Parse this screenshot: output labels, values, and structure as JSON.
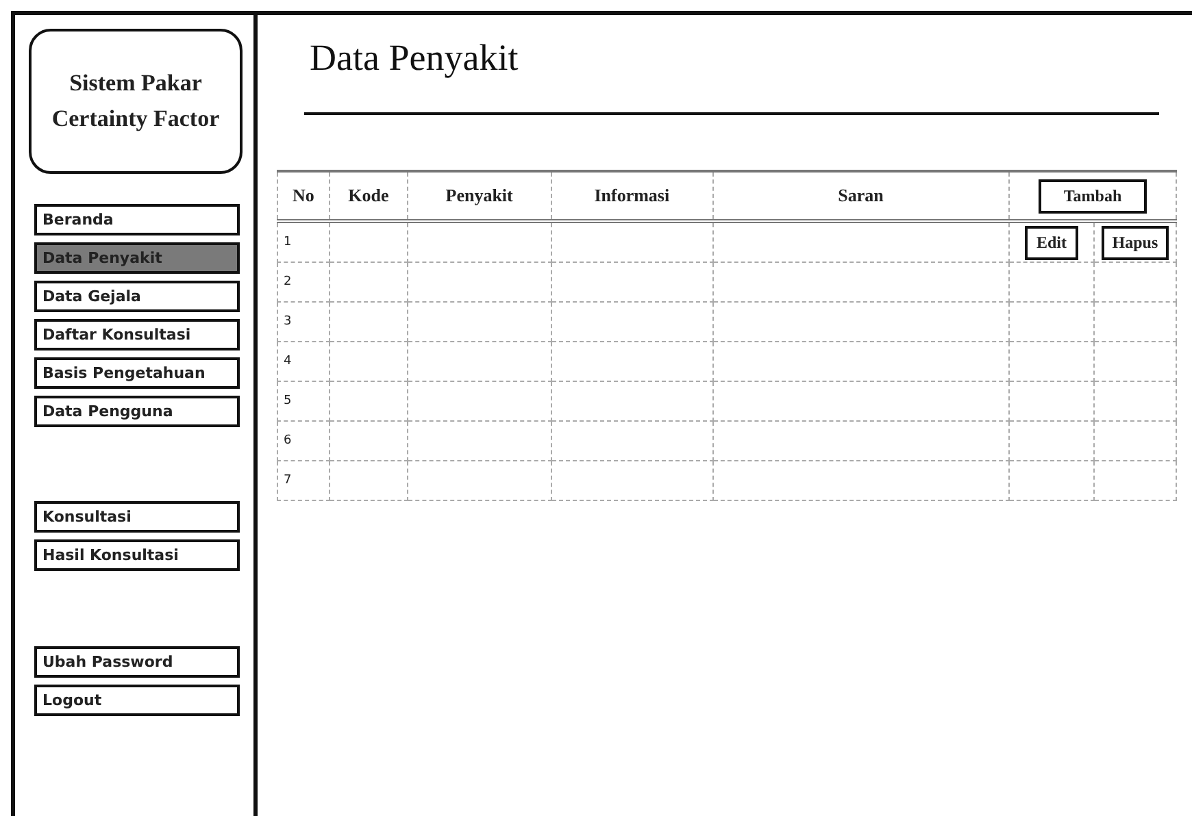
{
  "sidebar": {
    "title": [
      "Sistem Pakar",
      "Certainty Factor"
    ],
    "menu_groups": [
      [
        {
          "label": "Beranda",
          "selected": false
        },
        {
          "label": "Data Penyakit",
          "selected": true
        },
        {
          "label": "Data Gejala",
          "selected": false
        },
        {
          "label": "Daftar Konsultasi",
          "selected": false
        },
        {
          "label": "Basis Pengetahuan",
          "selected": false
        },
        {
          "label": "Data Pengguna",
          "selected": false
        }
      ],
      [
        {
          "label": "Konsultasi",
          "selected": false
        },
        {
          "label": "Hasil Konsultasi",
          "selected": false
        }
      ],
      [
        {
          "label": "Ubah Password",
          "selected": false
        },
        {
          "label": "Logout",
          "selected": false
        }
      ]
    ]
  },
  "page_title": "Data Penyakit",
  "table": {
    "columns": [
      "No",
      "Kode",
      "Penyakit",
      "Informasi",
      "Saran"
    ],
    "add_button": "Tambah",
    "rows": [
      {
        "no": "1",
        "actions": [
          "Edit",
          "Hapus"
        ]
      },
      {
        "no": "2"
      },
      {
        "no": "3"
      },
      {
        "no": "4"
      },
      {
        "no": "5"
      },
      {
        "no": "6"
      },
      {
        "no": "7"
      }
    ]
  }
}
